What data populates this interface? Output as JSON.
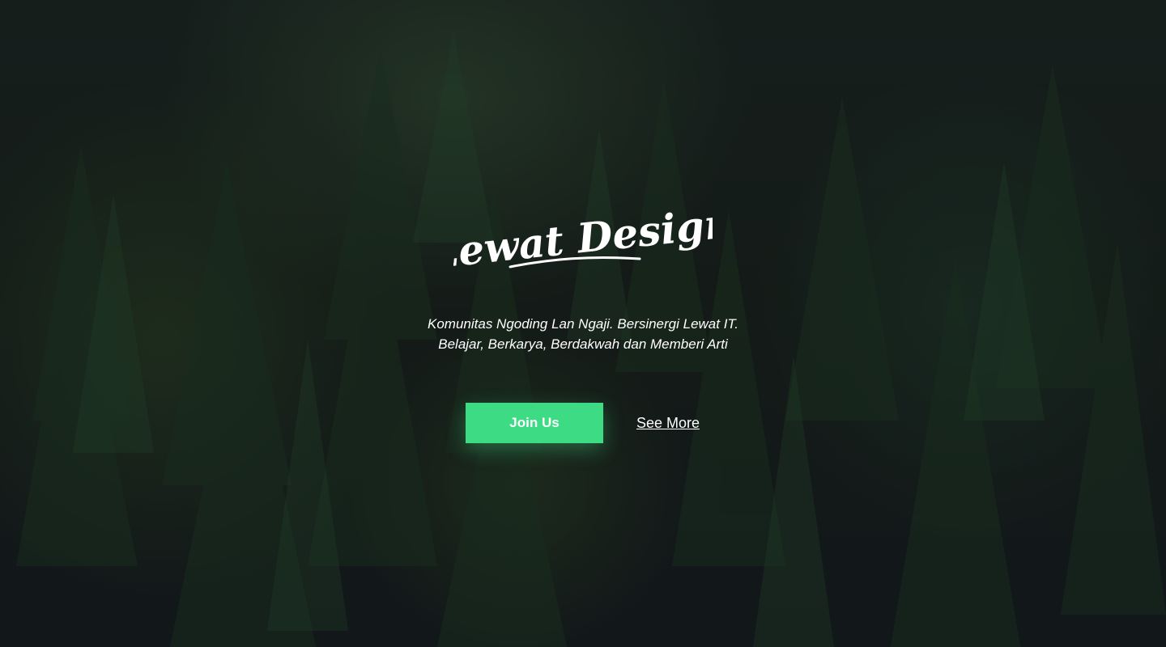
{
  "brand": {
    "logo_text": "Lewat Design"
  },
  "hero": {
    "tagline_line1": "Komunitas Ngoding Lan Ngaji. Bersinergi Lewat IT.",
    "tagline_line2": "Belajar, Berkarya, Berdakwah dan Memberi Arti"
  },
  "actions": {
    "join_label": "Join Us",
    "more_label": "See More"
  },
  "colors": {
    "accent": "#3ddc84",
    "background": "#161b1f",
    "text": "#ffffff"
  },
  "background_image": "pine-forest-photo"
}
